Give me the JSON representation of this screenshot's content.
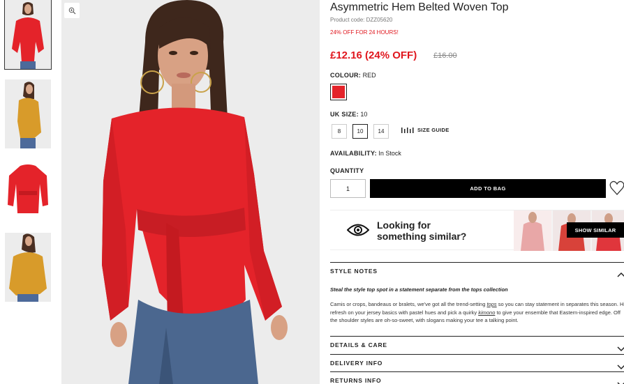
{
  "product": {
    "title": "Asymmetric Hem Belted Woven Top",
    "code": "Product code: DZZ05620",
    "promo": "24% OFF FOR 24 HOURS!",
    "price": "£12.16 (24% OFF)",
    "was_price": "£16.00"
  },
  "colour": {
    "label": "COLOUR:",
    "value": "RED",
    "swatch": "#e4232a"
  },
  "size": {
    "label": "UK SIZE:",
    "value": "10",
    "options": [
      "8",
      "10",
      "14"
    ],
    "guide_label": "SIZE GUIDE"
  },
  "availability": {
    "label": "AVAILABILITY:",
    "value": "In Stock"
  },
  "quantity": {
    "label": "QUANTITY",
    "value": "1"
  },
  "cta": {
    "add_to_bag": "ADD TO BAG"
  },
  "similar": {
    "line1": "Looking for",
    "line2": "something similar?",
    "button": "SHOW SIMILAR"
  },
  "sections": {
    "style_notes": "STYLE NOTES",
    "tagline": "Steal the style top spot in a statement separate from the tops collection",
    "notes_a": "Camis or crops, bandeaus or bralets, we've got all the trend-setting ",
    "notes_link1": "tops",
    "notes_b": " so you can stay statement in separates this season. Hit refresh on your jersey basics with pastel hues and pick a quirky ",
    "notes_link2": "kimono",
    "notes_c": " to give your ensemble that Eastern-inspired edge. Off the shoulder styles are oh-so-sweet, with slogans making your tee a talking point.",
    "details": "DETAILS & CARE",
    "delivery": "DELIVERY INFO",
    "returns": "RETURNS INFO"
  },
  "icons": [
    "zoom-icon",
    "size-guide-icon",
    "heart-icon",
    "eye-icon",
    "chevron-up-icon",
    "chevron-down-icon"
  ],
  "colors": {
    "sale_red": "#e0161d",
    "product_red": "#e4232a",
    "mustard": "#d89b2a",
    "black": "#000000"
  }
}
